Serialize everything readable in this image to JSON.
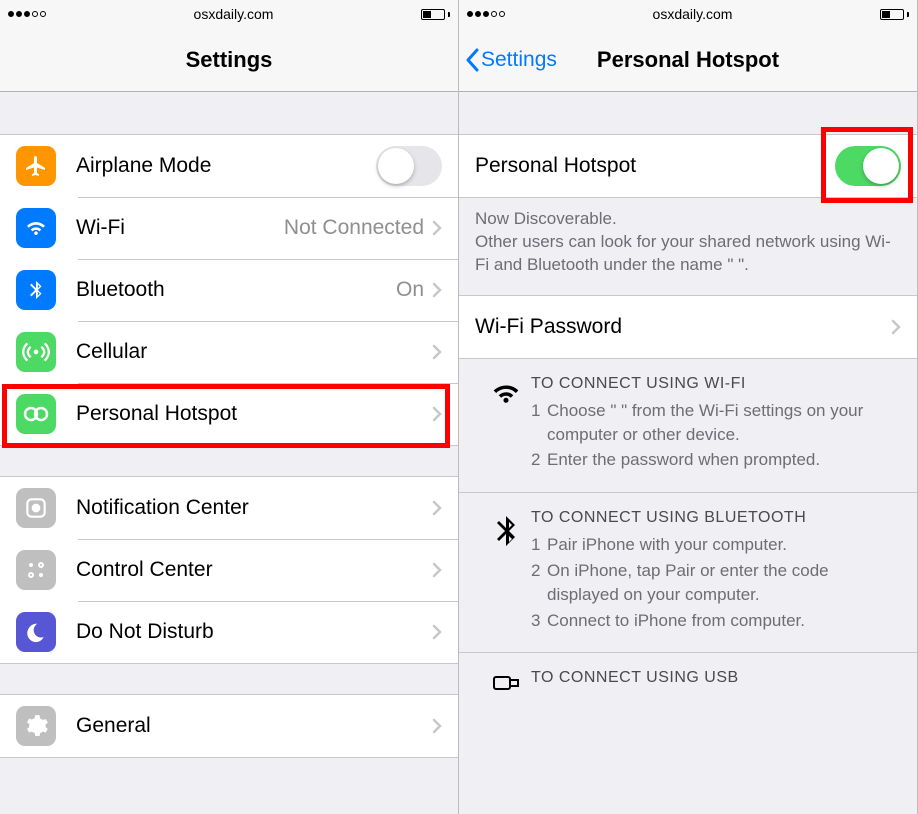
{
  "left": {
    "status": {
      "url": "osxdaily.com"
    },
    "nav": {
      "title": "Settings"
    },
    "group1": [
      {
        "id": "airplane",
        "label": "Airplane Mode",
        "icon": "airplane",
        "bg": "bg-orange",
        "toggle": false
      },
      {
        "id": "wifi",
        "label": "Wi-Fi",
        "value": "Not Connected",
        "icon": "wifi",
        "bg": "bg-blue",
        "chevron": true
      },
      {
        "id": "bluetooth",
        "label": "Bluetooth",
        "value": "On",
        "icon": "bluetooth",
        "bg": "bg-blue",
        "chevron": true
      },
      {
        "id": "cellular",
        "label": "Cellular",
        "icon": "cellular",
        "bg": "bg-green",
        "chevron": true
      },
      {
        "id": "hotspot",
        "label": "Personal Hotspot",
        "icon": "hotspot",
        "bg": "bg-green",
        "chevron": true
      }
    ],
    "group2": [
      {
        "id": "notif",
        "label": "Notification Center",
        "icon": "notif",
        "bg": "bg-gray",
        "chevron": true
      },
      {
        "id": "control",
        "label": "Control Center",
        "icon": "control",
        "bg": "bg-gray",
        "chevron": true
      },
      {
        "id": "dnd",
        "label": "Do Not Disturb",
        "icon": "moon",
        "bg": "bg-purple",
        "chevron": true
      }
    ],
    "group3": [
      {
        "id": "general",
        "label": "General",
        "icon": "gear",
        "bg": "bg-gray",
        "chevron": true
      }
    ]
  },
  "right": {
    "status": {
      "url": "osxdaily.com"
    },
    "nav": {
      "back": "Settings",
      "title": "Personal Hotspot"
    },
    "toggleRow": {
      "label": "Personal Hotspot",
      "on": true
    },
    "discoverable": {
      "line1": "Now Discoverable.",
      "line2": "Other users can look for your shared network using Wi-Fi and Bluetooth under the name \"                          \"."
    },
    "passwordRow": {
      "label": "Wi-Fi Password"
    },
    "instructions": [
      {
        "icon": "wifi",
        "title": "TO CONNECT USING WI-FI",
        "steps": [
          "Choose \"                         \" from the Wi-Fi settings on your computer or other device.",
          "Enter the password when prompted."
        ]
      },
      {
        "icon": "bluetooth",
        "title": "TO CONNECT USING BLUETOOTH",
        "steps": [
          "Pair iPhone with your computer.",
          "On iPhone, tap Pair or enter the code displayed on your computer.",
          "Connect to iPhone from computer."
        ]
      },
      {
        "icon": "usb",
        "title": "TO CONNECT USING USB",
        "steps": []
      }
    ]
  }
}
